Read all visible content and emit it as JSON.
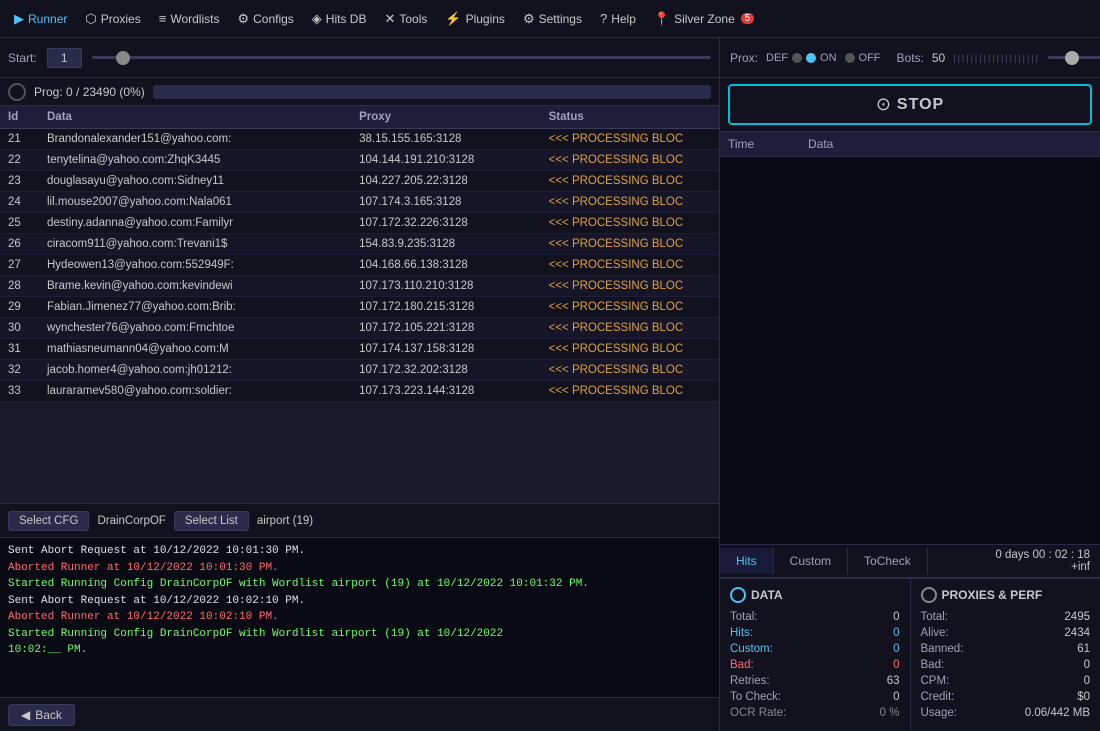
{
  "nav": {
    "items": [
      {
        "id": "runner",
        "icon": "▶",
        "label": "Runner",
        "active": true
      },
      {
        "id": "proxies",
        "icon": "⬡",
        "label": "Proxies"
      },
      {
        "id": "wordlists",
        "icon": "≡",
        "label": "Wordlists"
      },
      {
        "id": "configs",
        "icon": "⚙",
        "label": "Configs"
      },
      {
        "id": "hitsdb",
        "icon": "◈",
        "label": "Hits DB"
      },
      {
        "id": "tools",
        "icon": "✕",
        "label": "Tools"
      },
      {
        "id": "plugins",
        "icon": "⚡",
        "label": "Plugins"
      },
      {
        "id": "settings",
        "icon": "⚙",
        "label": "Settings"
      },
      {
        "id": "help",
        "icon": "?",
        "label": "Help"
      },
      {
        "id": "silverzone",
        "icon": "📍",
        "label": "Silver Zone",
        "badge": "5"
      }
    ]
  },
  "controls": {
    "start_label": "Start:",
    "start_value": "1",
    "bots_label": "Bots:",
    "bots_value": "50"
  },
  "progress": {
    "text": "Prog: 0 / 23490 (0%)"
  },
  "table": {
    "headers": [
      "Id",
      "Data",
      "Proxy",
      "Status"
    ],
    "rows": [
      {
        "id": "21",
        "data": "Brandonalexander151@yahoo.com:",
        "proxy": "38.15.155.165:3128",
        "status": "<<< PROCESSING BLOC"
      },
      {
        "id": "22",
        "data": "tenytelina@yahoo.com:ZhqK3445",
        "proxy": "104.144.191.210:3128",
        "status": "<<< PROCESSING BLOC"
      },
      {
        "id": "23",
        "data": "douglasayu@yahoo.com:Sidney11",
        "proxy": "104.227.205.22:3128",
        "status": "<<< PROCESSING BLOC"
      },
      {
        "id": "24",
        "data": "lil.mouse2007@yahoo.com:Nala061",
        "proxy": "107.174.3.165:3128",
        "status": "<<< PROCESSING BLOC"
      },
      {
        "id": "25",
        "data": "destiny.adanna@yahoo.com:Familyr",
        "proxy": "107.172.32.226:3128",
        "status": "<<< PROCESSING BLOC"
      },
      {
        "id": "26",
        "data": "ciracom911@yahoo.com:Trevani1$",
        "proxy": "154.83.9.235:3128",
        "status": "<<< PROCESSING BLOC"
      },
      {
        "id": "27",
        "data": "Hydeowen13@yahoo.com:552949F:",
        "proxy": "104.168.66.138:3128",
        "status": "<<< PROCESSING BLOC"
      },
      {
        "id": "28",
        "data": "Brame.kevin@yahoo.com:kevindewi",
        "proxy": "107.173.110.210:3128",
        "status": "<<< PROCESSING BLOC"
      },
      {
        "id": "29",
        "data": "Fabian.Jimenez77@yahoo.com:Brib:",
        "proxy": "107.172.180.215:3128",
        "status": "<<< PROCESSING BLOC"
      },
      {
        "id": "30",
        "data": "wynchester76@yahoo.com:Frnchtoe",
        "proxy": "107.172.105.221:3128",
        "status": "<<< PROCESSING BLOC"
      },
      {
        "id": "31",
        "data": "mathiasneumann04@yahoo.com:M",
        "proxy": "107.174.137.158:3128",
        "status": "<<< PROCESSING BLOC"
      },
      {
        "id": "32",
        "data": "jacob.homer4@yahoo.com:jh01212:",
        "proxy": "107.172.32.202:3128",
        "status": "<<< PROCESSING BLOC"
      },
      {
        "id": "33",
        "data": "lauraramev580@yahoo.com:soldier:",
        "proxy": "107.173.223.144:3128",
        "status": "<<< PROCESSING BLOC"
      }
    ]
  },
  "toolbar": {
    "select_cfg": "Select CFG",
    "config_name": "DrainCorpOF",
    "select_list": "Select List",
    "list_name": "airport (19)"
  },
  "log": {
    "entries": [
      {
        "type": "normal",
        "text": "Sent Abort Request at 10/12/2022 10:01:30 PM."
      },
      {
        "type": "aborted",
        "text": "Aborted Runner at 10/12/2022 10:01:30 PM."
      },
      {
        "type": "started",
        "text": "Started Running Config DrainCorpOF with Wordlist airport (19) at 10/12/2022 10:01:32 PM."
      },
      {
        "type": "normal",
        "text": "Sent Abort Request at 10/12/2022 10:02:10 PM."
      },
      {
        "type": "aborted",
        "text": "Aborted Runner at 10/12/2022 10:02:10 PM."
      },
      {
        "type": "started",
        "text": "Started Running Config DrainCorpOF with Wordlist airport (19) at 10/12/2022"
      },
      {
        "type": "started",
        "text": "10:02:__ PM."
      }
    ]
  },
  "back_btn": "◀ Back",
  "right": {
    "proxy_label": "Prox:",
    "toggle_def": "DEF",
    "toggle_on": "ON",
    "toggle_off": "OFF",
    "stop_label": "STOP",
    "log_header_time": "Time",
    "log_header_data": "Data",
    "tabs": [
      {
        "id": "hits",
        "label": "Hits",
        "active": true
      },
      {
        "id": "custom",
        "label": "Custom"
      },
      {
        "id": "tocheck",
        "label": "ToCheck"
      }
    ],
    "timer": {
      "line1": "0 days  00 : 02 : 18",
      "line2": "+inf"
    },
    "data_stats": {
      "header": "DATA",
      "total_label": "Total:",
      "total_value": "0",
      "hits_label": "Hits:",
      "hits_value": "0",
      "custom_label": "Custom:",
      "custom_value": "0",
      "bad_label": "Bad:",
      "bad_value": "0",
      "retries_label": "Retries:",
      "retries_value": "63",
      "tocheck_label": "To Check:",
      "tocheck_value": "0",
      "ocr_label": "OCR Rate:",
      "ocr_value": "0 %"
    },
    "perf_stats": {
      "header": "PROXIES & PERF",
      "total_label": "Total:",
      "total_value": "2495",
      "alive_label": "Alive:",
      "alive_value": "2434",
      "banned_label": "Banned:",
      "banned_value": "61",
      "bad_label": "Bad:",
      "bad_value": "0",
      "cpm_label": "CPM:",
      "cpm_value": "0",
      "credit_label": "Credit:",
      "credit_value": "$0",
      "usage_label": "Usage:",
      "usage_value": "0.06/442 MB"
    }
  }
}
